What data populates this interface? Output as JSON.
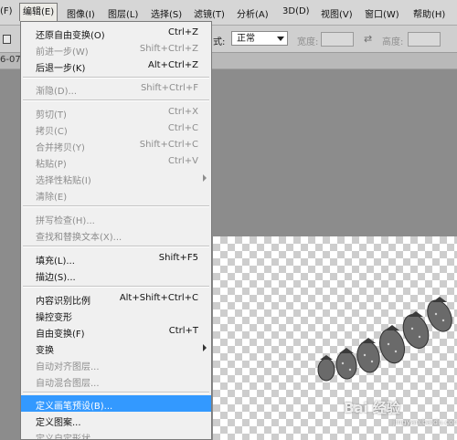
{
  "menubar": {
    "items": [
      {
        "label": "(F)"
      },
      {
        "label": "编辑(E)"
      },
      {
        "label": "图像(I)"
      },
      {
        "label": "图层(L)"
      },
      {
        "label": "选择(S)"
      },
      {
        "label": "滤镜(T)"
      },
      {
        "label": "分析(A)"
      },
      {
        "label": "3D(D)"
      },
      {
        "label": "视图(V)"
      },
      {
        "label": "窗口(W)"
      },
      {
        "label": "帮助(H)"
      }
    ]
  },
  "options_bar": {
    "mode_label": "式:",
    "mode_value": "正常",
    "width_label": "宽度:",
    "swap_icon": "swap-arrows-icon",
    "height_label": "高度:"
  },
  "document_tab": {
    "label": "6-07"
  },
  "edit_menu": {
    "items": [
      {
        "label": "还原自由变换(O)",
        "shortcut": "Ctrl+Z",
        "disabled": false
      },
      {
        "label": "前进一步(W)",
        "shortcut": "Shift+Ctrl+Z",
        "disabled": true
      },
      {
        "label": "后退一步(K)",
        "shortcut": "Alt+Ctrl+Z",
        "disabled": false
      },
      {
        "label": "渐隐(D)...",
        "shortcut": "Shift+Ctrl+F",
        "disabled": true
      },
      {
        "label": "剪切(T)",
        "shortcut": "Ctrl+X",
        "disabled": true
      },
      {
        "label": "拷贝(C)",
        "shortcut": "Ctrl+C",
        "disabled": true
      },
      {
        "label": "合并拷贝(Y)",
        "shortcut": "Shift+Ctrl+C",
        "disabled": true
      },
      {
        "label": "粘贴(P)",
        "shortcut": "Ctrl+V",
        "disabled": true
      },
      {
        "label": "选择性粘贴(I)",
        "shortcut": "",
        "disabled": true,
        "submenu": true
      },
      {
        "label": "清除(E)",
        "shortcut": "",
        "disabled": true
      },
      {
        "label": "拼写检查(H)...",
        "shortcut": "",
        "disabled": true
      },
      {
        "label": "查找和替换文本(X)...",
        "shortcut": "",
        "disabled": true
      },
      {
        "label": "填充(L)...",
        "shortcut": "Shift+F5",
        "disabled": false
      },
      {
        "label": "描边(S)...",
        "shortcut": "",
        "disabled": false
      },
      {
        "label": "内容识别比例",
        "shortcut": "Alt+Shift+Ctrl+C",
        "disabled": false
      },
      {
        "label": "操控变形",
        "shortcut": "",
        "disabled": false
      },
      {
        "label": "自由变换(F)",
        "shortcut": "Ctrl+T",
        "disabled": false
      },
      {
        "label": "变换",
        "shortcut": "",
        "disabled": false,
        "submenu": true
      },
      {
        "label": "自动对齐图层...",
        "shortcut": "",
        "disabled": true
      },
      {
        "label": "自动混合图层...",
        "shortcut": "",
        "disabled": true
      },
      {
        "label": "定义画笔预设(B)...",
        "shortcut": "",
        "disabled": false,
        "highlighted": true
      },
      {
        "label": "定义图案...",
        "shortcut": "",
        "disabled": false
      },
      {
        "label": "定义自定形状...",
        "shortcut": "",
        "disabled": true
      }
    ]
  },
  "watermark": {
    "main": "Bai 经验",
    "sub": "jingyan.baidu.com"
  },
  "colors": {
    "highlight": "#3399ff",
    "menu_bg": "#f0f0f0",
    "disabled_text": "#8d8d8d"
  }
}
